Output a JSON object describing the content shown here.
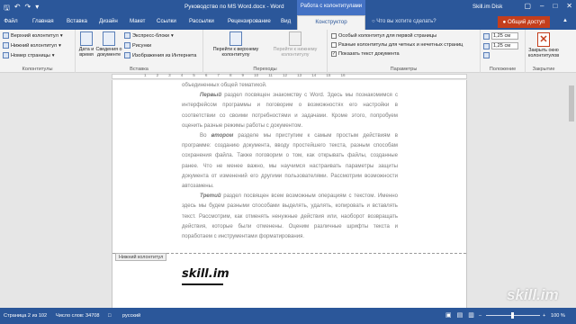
{
  "titlebar": {
    "title": "Руководство по MS Word.docx - Word",
    "context_tab": "Работа с колонтитулами",
    "user": "Skill.im Disk",
    "qat_icons": [
      "save-icon",
      "undo-icon",
      "redo-icon",
      "customize-icon"
    ],
    "win_buttons": [
      "ribbon-display-icon",
      "minimize-icon",
      "maximize-icon",
      "close-icon"
    ]
  },
  "tabs": {
    "items": [
      "Файл",
      "Главная",
      "Вставка",
      "Дизайн",
      "Макет",
      "Ссылки",
      "Рассылки",
      "Рецензирование",
      "Вид",
      "Конструктор"
    ],
    "active": "Конструктор",
    "tell_me": "Что вы хотите сделать?",
    "share": "Общий доступ"
  },
  "ribbon": {
    "kolontituly": {
      "items": [
        "Верхний колонтитул",
        "Нижний колонтитул",
        "Номер страницы"
      ],
      "label": "Колонтитулы"
    },
    "vstavka": {
      "date_time": "Дата и время",
      "doc_info": "Сведения о документе",
      "express": "Экспресс-блоки",
      "pictures": "Рисунки",
      "online_pictures": "Изображения из Интернета",
      "label": "Вставка"
    },
    "perehody": {
      "goto_header": "Перейти к верхнему колонтитулу",
      "goto_footer": "Перейти к нижнему колонтитулу",
      "label": "Переходы"
    },
    "parametry": {
      "options": [
        {
          "label": "Особый колонтитул для первой страницы",
          "checked": false
        },
        {
          "label": "Разные колонтитулы для четных и нечетных страниц",
          "checked": false
        },
        {
          "label": "Показать текст документа",
          "checked": true
        }
      ],
      "label": "Параметры"
    },
    "polozhenie": {
      "top_value": "1,25 см",
      "bottom_value": "1,25 см",
      "label": "Положение"
    },
    "zakrytie": {
      "close_label": "Закрыть окно колонтитулов",
      "label": "Закрытие"
    }
  },
  "ruler": {
    "numbers": [
      "1",
      "2",
      "3",
      "4",
      "5",
      "6",
      "7",
      "8",
      "9",
      "10",
      "11",
      "12",
      "13",
      "14",
      "15",
      "16"
    ]
  },
  "document": {
    "p0": "объединенных общей тематикой.",
    "p1_bold": "Первый",
    "p1_rest": " раздел посвящен знакомству с Word. Здесь мы познакомимся с интерфейсом программы и поговорим о возможностях его настройки в соответствии со своими потребностями и задачами. Кроме этого, попробуем оценить разные режимы работы с документом.",
    "p2_lead": "Во ",
    "p2_bold": "втором",
    "p2_rest": " разделе мы приступим к самым простым действиям в программе: созданию документа, вводу простейшего текста, разным способам сохранения файла. Также поговорим о том, как открывать файлы, созданные ранее. Что не менее важно, мы научимся настраивать параметры защиты документа от изменений его другими пользователями. Рассмотрим возможности автозамены.",
    "p3_bold": "Третий",
    "p3_rest": " раздел посвящен всем возможным операциям с текстом. Именно здесь мы будем разными способами выделять, удалять, копировать и вставлять текст. Рассмотрим, как отменять ненужные действия или, наоборот возвращать действия, которые были отменены. Оценим различные шрифты текста и поработаем с инструментами форматирования.",
    "footer_tag": "Нижний колонтитул",
    "footer_logo": "skill.im"
  },
  "statusbar": {
    "page": "Страница 2 из 102",
    "words": "Число слов: 34708",
    "lang": "русский",
    "zoom": "100 %"
  },
  "watermark": "skill.im"
}
